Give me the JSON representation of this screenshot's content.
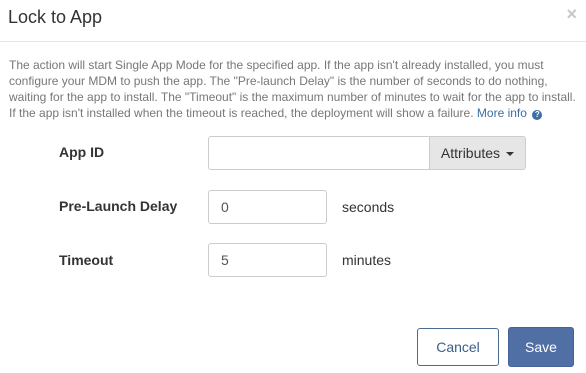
{
  "modal": {
    "title": "Lock to App",
    "close_label": "×",
    "description": "The action will start Single App Mode for the specified app. If the app isn't already installed, you must configure your MDM to push the app. The \"Pre-launch Delay\" is the number of seconds to do nothing, waiting for the app to install. The \"Timeout\" is the maximum number of minutes to wait for the app to install. If the app isn't installed when the timeout is reached, the deployment will show a failure.",
    "more_info_label": "More info",
    "info_icon_glyph": "?"
  },
  "form": {
    "app_id": {
      "label": "App ID",
      "value": "",
      "attributes_label": "Attributes"
    },
    "pre_launch_delay": {
      "label": "Pre-Launch Delay",
      "value": "0",
      "unit": "seconds"
    },
    "timeout": {
      "label": "Timeout",
      "value": "5",
      "unit": "minutes"
    }
  },
  "footer": {
    "cancel_label": "Cancel",
    "save_label": "Save"
  },
  "colors": {
    "accent": "#4f6fa5",
    "link": "#3a6ea5",
    "muted_text": "#777777"
  },
  "icons": {
    "close": "close-icon",
    "info": "question-circle-icon",
    "dropdown": "caret-down-icon"
  }
}
